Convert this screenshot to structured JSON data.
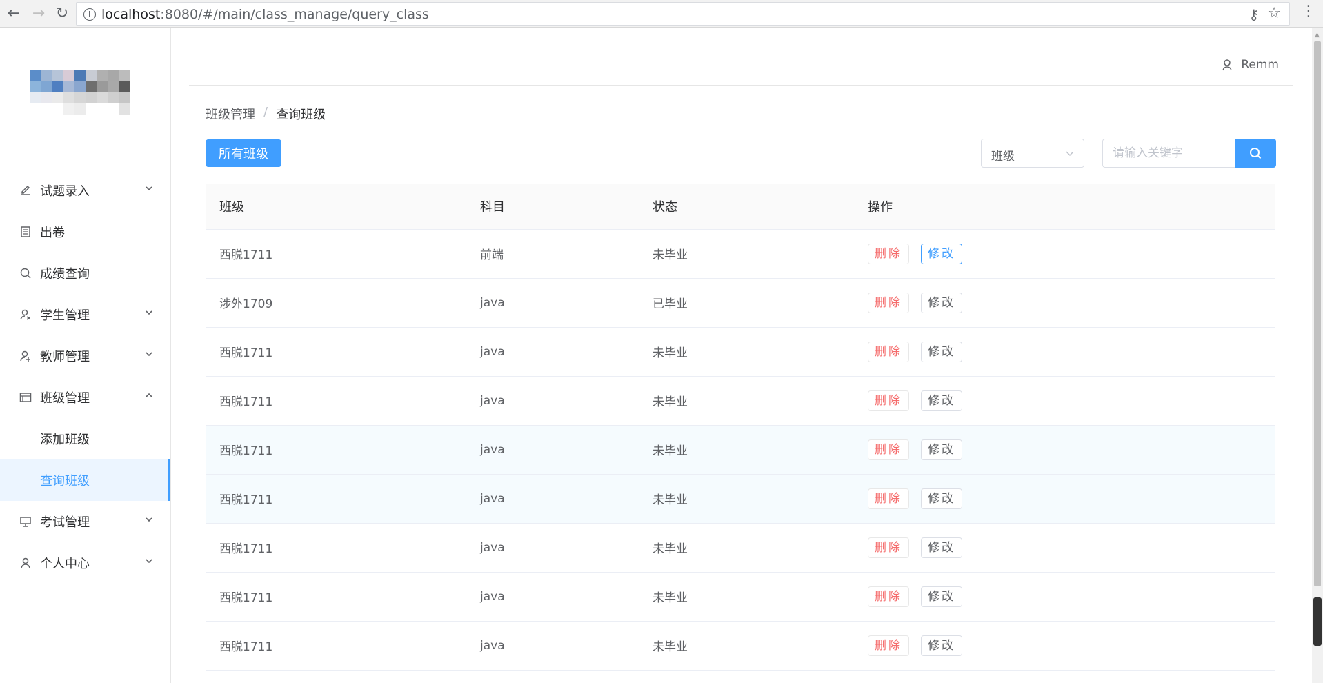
{
  "browser": {
    "url_host": "localhost",
    "url_path": ":8080/#/main/class_manage/query_class"
  },
  "sidebar": {
    "items": [
      {
        "label": "试题录入",
        "icon": "edit-icon",
        "expandable": true
      },
      {
        "label": "出卷",
        "icon": "document-icon",
        "expandable": false
      },
      {
        "label": "成绩查询",
        "icon": "search-icon",
        "expandable": false
      },
      {
        "label": "学生管理",
        "icon": "student-icon",
        "expandable": true
      },
      {
        "label": "教师管理",
        "icon": "teacher-icon",
        "expandable": true
      },
      {
        "label": "班级管理",
        "icon": "class-icon",
        "expandable": true,
        "expanded": true
      },
      {
        "label": "添加班级",
        "sub": true
      },
      {
        "label": "查询班级",
        "sub": true,
        "active": true
      },
      {
        "label": "考试管理",
        "icon": "monitor-icon",
        "expandable": true
      },
      {
        "label": "个人中心",
        "icon": "person-icon",
        "expandable": true
      }
    ]
  },
  "header": {
    "username": "Remm"
  },
  "breadcrumb": {
    "parent": "班级管理",
    "separator": "/",
    "current": "查询班级"
  },
  "toolbar": {
    "all_classes_label": "所有班级",
    "filter_value": "班级",
    "search_placeholder": "请输入关键字"
  },
  "table": {
    "columns": [
      "班级",
      "科目",
      "状态",
      "操作"
    ],
    "delete_label": "删除",
    "edit_label": "修改",
    "rows": [
      {
        "class": "西脱1711",
        "subject": "前端",
        "status": "未毕业"
      },
      {
        "class": "涉外1709",
        "subject": "java",
        "status": "已毕业"
      },
      {
        "class": "西脱1711",
        "subject": "java",
        "status": "未毕业"
      },
      {
        "class": "西脱1711",
        "subject": "java",
        "status": "未毕业"
      },
      {
        "class": "西脱1711",
        "subject": "java",
        "status": "未毕业"
      },
      {
        "class": "西脱1711",
        "subject": "java",
        "status": "未毕业"
      },
      {
        "class": "西脱1711",
        "subject": "java",
        "status": "未毕业"
      },
      {
        "class": "西脱1711",
        "subject": "java",
        "status": "未毕业"
      },
      {
        "class": "西脱1711",
        "subject": "java",
        "status": "未毕业"
      }
    ]
  },
  "colors": {
    "primary": "#409eff",
    "danger": "#f56c6c",
    "active_bg": "#ecf5ff"
  }
}
